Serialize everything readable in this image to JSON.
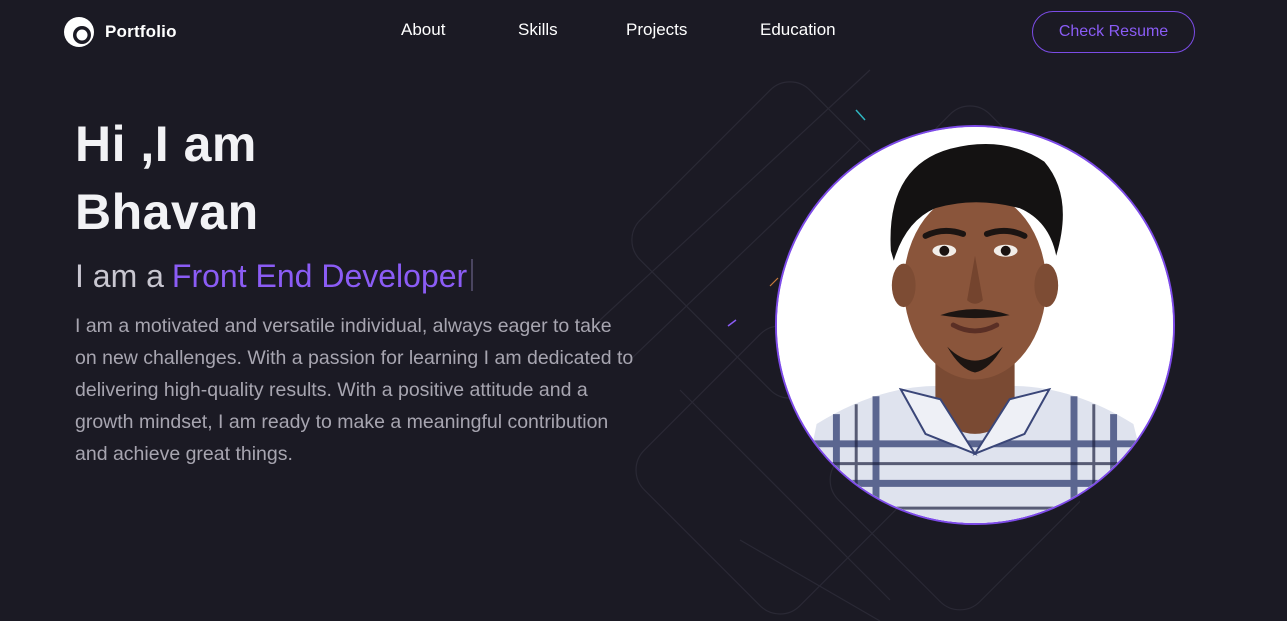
{
  "header": {
    "logo_text": "Portfolio",
    "nav": [
      {
        "label": "About"
      },
      {
        "label": "Skills"
      },
      {
        "label": "Projects"
      },
      {
        "label": "Education"
      }
    ],
    "resume_button_label": "Check Resume"
  },
  "hero": {
    "greeting_line1": "Hi ,I am",
    "greeting_line2": "Bhavan",
    "role_prefix": "I am a",
    "role_value": "Front End Developer",
    "bio": "I am a motivated and versatile individual, always eager to take on new challenges. With a passion for learning I am dedicated to delivering high-quality results. With a positive attitude and a growth mindset, I am ready to make a meaningful contribution and achieve great things."
  },
  "icons": {
    "logo": "portfolio-logo-icon"
  },
  "colors": {
    "background": "#1b1a24",
    "accent": "#8b5cf5",
    "border_accent": "#7d4be8",
    "body_text": "#a7a5b0"
  }
}
